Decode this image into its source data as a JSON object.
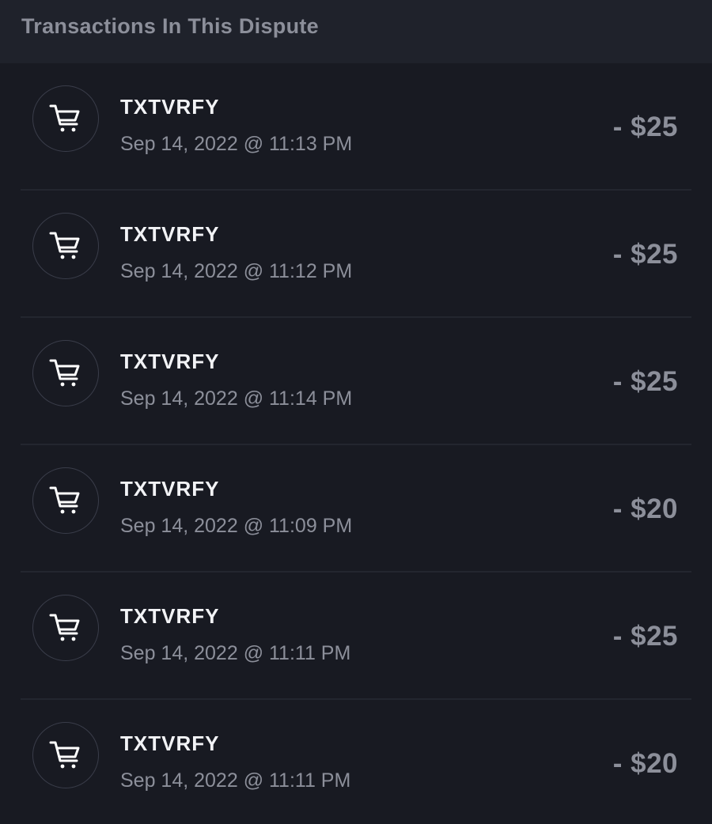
{
  "header": {
    "title": "Transactions In This Dispute"
  },
  "transactions": [
    {
      "merchant": "TXTVRFY",
      "datetime": "Sep 14, 2022 @ 11:13 PM",
      "amount": "- $25",
      "icon": "shopping-cart-icon"
    },
    {
      "merchant": "TXTVRFY",
      "datetime": "Sep 14, 2022 @ 11:12 PM",
      "amount": "- $25",
      "icon": "shopping-cart-icon"
    },
    {
      "merchant": "TXTVRFY",
      "datetime": "Sep 14, 2022 @ 11:14 PM",
      "amount": "- $25",
      "icon": "shopping-cart-icon"
    },
    {
      "merchant": "TXTVRFY",
      "datetime": "Sep 14, 2022 @ 11:09 PM",
      "amount": "- $20",
      "icon": "shopping-cart-icon"
    },
    {
      "merchant": "TXTVRFY",
      "datetime": "Sep 14, 2022 @ 11:11 PM",
      "amount": "- $25",
      "icon": "shopping-cart-icon"
    },
    {
      "merchant": "TXTVRFY",
      "datetime": "Sep 14, 2022 @ 11:11 PM",
      "amount": "- $20",
      "icon": "shopping-cart-icon"
    }
  ],
  "colors": {
    "background": "#181a22",
    "header_background": "#1f222b",
    "primary_text": "#f2f3f6",
    "secondary_text": "#8c8f9a"
  }
}
